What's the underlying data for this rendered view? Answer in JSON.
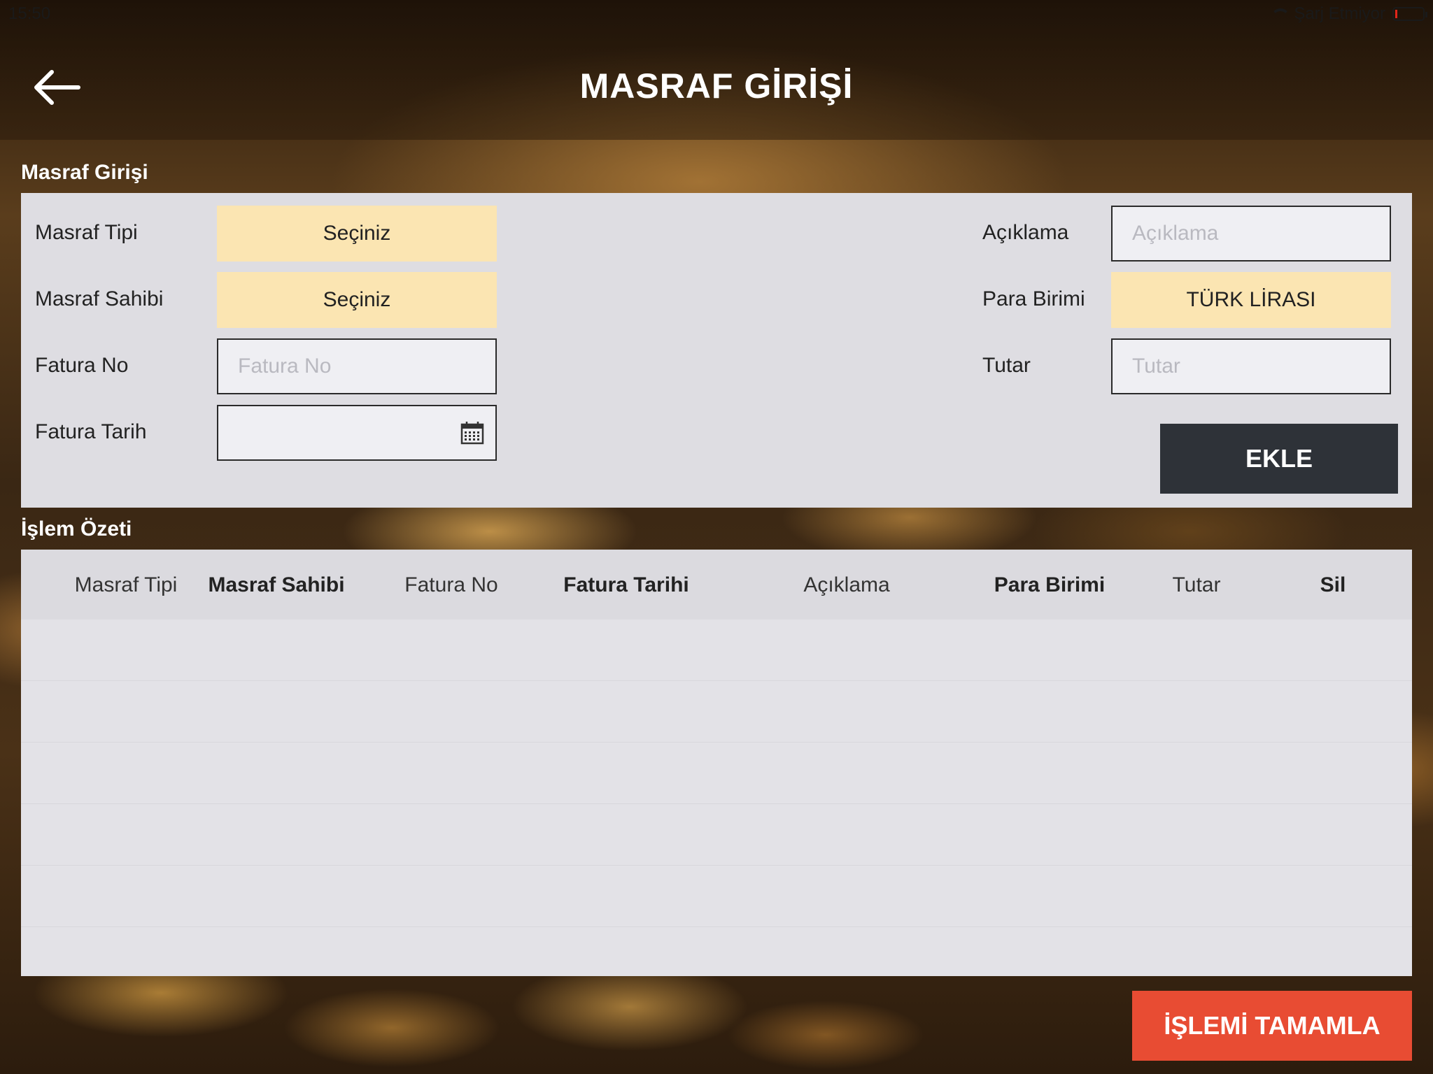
{
  "status_bar": {
    "time": "15:50",
    "charging_text": "Şarj Etmiyor"
  },
  "header": {
    "title": "MASRAF GİRİŞİ"
  },
  "form": {
    "section_title": "Masraf Girişi",
    "masraf_tipi": {
      "label": "Masraf Tipi",
      "value": "Seçiniz"
    },
    "masraf_sahibi": {
      "label": "Masraf Sahibi",
      "value": "Seçiniz"
    },
    "fatura_no": {
      "label": "Fatura No",
      "placeholder": "Fatura No"
    },
    "fatura_tarih": {
      "label": "Fatura Tarih"
    },
    "aciklama": {
      "label": "Açıklama",
      "placeholder": "Açıklama"
    },
    "para_birimi": {
      "label": "Para Birimi",
      "value": "TÜRK LİRASI"
    },
    "tutar": {
      "label": "Tutar",
      "placeholder": "Tutar"
    },
    "add_button": "EKLE"
  },
  "summary": {
    "section_title": "İşlem Özeti",
    "columns": [
      "Masraf Tipi",
      "Masraf Sahibi",
      "Fatura No",
      "Fatura Tarihi",
      "Açıklama",
      "Para Birimi",
      "Tutar",
      "Sil"
    ],
    "rows": []
  },
  "complete_button": "İŞLEMİ TAMAMLA",
  "colors": {
    "select_bg": "#fbe5b2",
    "add_button_bg": "#2e3238",
    "complete_button_bg": "#e84c33",
    "panel_bg": "#dedde2"
  }
}
